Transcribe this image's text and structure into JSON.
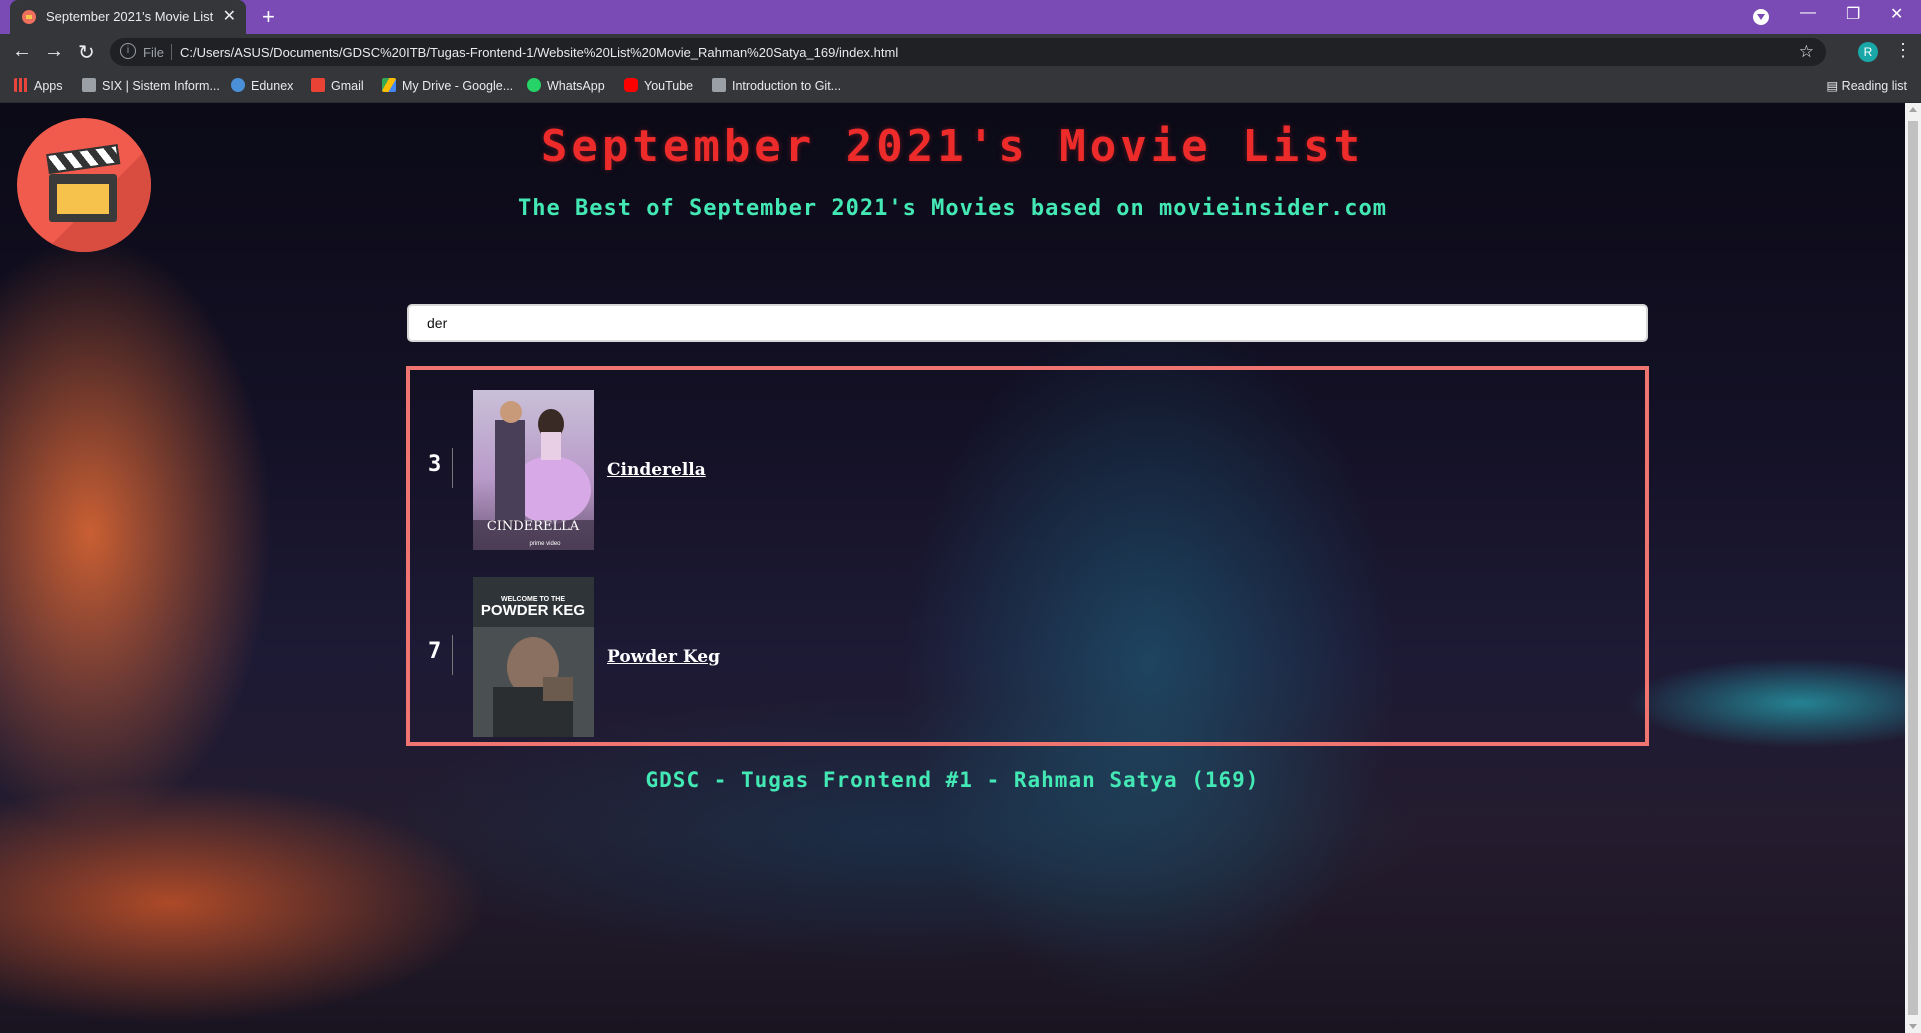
{
  "browser": {
    "tab_title": "September 2021's Movie List",
    "tab_close": "✕",
    "new_tab": "+",
    "scheme": "File",
    "url": "C:/Users/ASUS/Documents/GDSC%20ITB/Tugas-Frontend-1/Website%20List%20Movie_Rahman%20Satya_169/index.html",
    "profile_initial": "R",
    "bookmarks": [
      {
        "label": "Apps",
        "icon": "apps-grid-icon",
        "color": "#e8453c"
      },
      {
        "label": "SIX | Sistem Inform...",
        "icon": "six-icon",
        "color": "#9aa0a6"
      },
      {
        "label": "Edunex",
        "icon": "edunex-icon",
        "color": "#4a90d9"
      },
      {
        "label": "Gmail",
        "icon": "gmail-icon",
        "color": "#ea4335"
      },
      {
        "label": "My Drive - Google...",
        "icon": "google-drive-icon",
        "color": "#fbbc04"
      },
      {
        "label": "WhatsApp",
        "icon": "whatsapp-icon",
        "color": "#25d366"
      },
      {
        "label": "YouTube",
        "icon": "youtube-icon",
        "color": "#ff0000"
      },
      {
        "label": "Introduction to Git...",
        "icon": "page-icon",
        "color": "#9aa0a6"
      }
    ],
    "reading_list": "Reading list"
  },
  "page": {
    "title": "September 2021's Movie List",
    "subtitle": "The Best of September 2021's Movies based on movieinsider.com",
    "search_value": "der",
    "results": [
      {
        "rank": "3",
        "name": "Cinderella",
        "poster_text": "CINDERELLA",
        "poster_sub": "prime video"
      },
      {
        "rank": "7",
        "name": "Powder Keg",
        "poster_text_top": "WELCOME TO THE",
        "poster_text": "POWDER KEG"
      }
    ],
    "footer": "GDSC - Tugas Frontend #1 - Rahman Satya (169)"
  },
  "colors": {
    "title": "#ee2b2b",
    "accent_green": "#43e8b4",
    "results_border": "#f07570",
    "tabbar": "#7a4ab5"
  }
}
